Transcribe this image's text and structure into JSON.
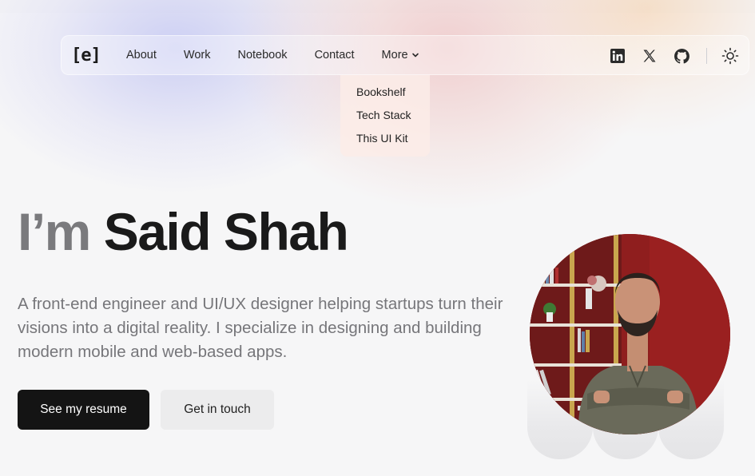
{
  "nav": {
    "logo": "[e]",
    "links": [
      "About",
      "Work",
      "Notebook",
      "Contact"
    ],
    "more_label": "More",
    "icons": [
      "linkedin-icon",
      "x-icon",
      "github-icon",
      "sun-icon"
    ]
  },
  "dropdown": {
    "items": [
      "Bookshelf",
      "Tech Stack",
      "This UI Kit"
    ]
  },
  "hero": {
    "greeting": "I’m",
    "name": "Said Shah",
    "description": "A front-end engineer and UI/UX designer helping startups turn their visions into a digital reality. I specialize in designing and building modern mobile and web-based apps.",
    "primary_button": "See my resume",
    "secondary_button": "Get in touch"
  },
  "colors": {
    "primary_button_bg": "#141414",
    "secondary_button_bg": "#ececed",
    "photo_bg": "#8a1f1f"
  }
}
